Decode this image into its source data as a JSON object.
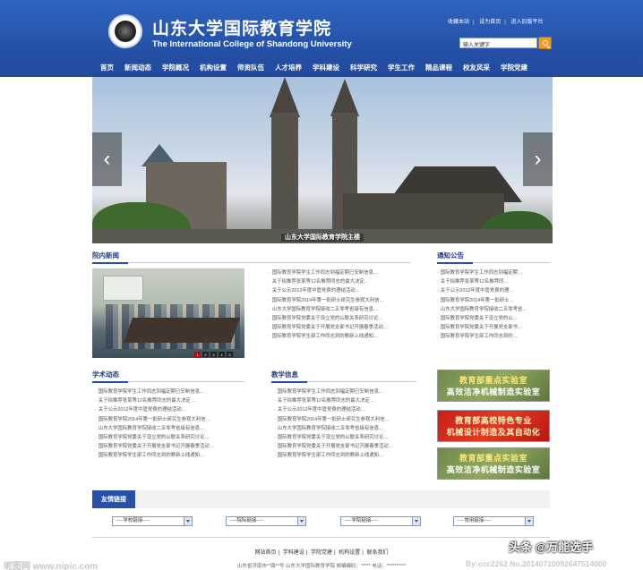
{
  "header": {
    "cn_title": "山东大学国际教育学院",
    "en_title": "The International College of Shandong University",
    "top_links": [
      "收藏本站",
      "设为首页",
      "进入旧版平台"
    ],
    "search_placeholder": "输入关键字",
    "nav": [
      "首页",
      "新闻动态",
      "学院概况",
      "机构设置",
      "师资队伍",
      "人才培养",
      "学科建设",
      "科学研究",
      "学生工作",
      "精品课程",
      "校友风采",
      "学院党建"
    ]
  },
  "banner": {
    "caption": "山东大学国际教育学院主楼",
    "prev": "‹",
    "next": "›"
  },
  "news": {
    "title": "院内新闻",
    "slides": [
      "1",
      "2",
      "3",
      "4",
      "5"
    ],
    "items": [
      "国际教育学院学生工作同志到福定期已安制信息…",
      "关于拟推荐张某等12名推荐同志的最大决定…",
      "关于公示2012年度中管党费的理结活动…",
      "国际教育学院2014年第一批研士研究生参观大利信…",
      "山东大学国际教育学院接收二五零考省级有信息…",
      "国际教育学院党委关于设立党的公联关系研究讨论…",
      "国际教育学院党委关于开展党支部书记开展春季活动…",
      "国际教育学院学生部工作同志到的教新上线通知…"
    ]
  },
  "notice": {
    "title": "通知公告",
    "items": [
      "国际教育学院学生工作同志到福定期…",
      "关于拟推荐张某等12名推荐同…",
      "关于公示2012年度中管党费的理…",
      "国际教育学院2014年第一批研士…",
      "山东大学国际教育学院接收二五零考省…",
      "国际教育学院党委关于设立党的公…",
      "国际教育学院党委关于开展党支部书…",
      "国际教育学院学生部工作同志到的…"
    ]
  },
  "academic": {
    "title": "学术动态",
    "items": [
      "国际教育学院学生工作同志到福定期已安制信息…",
      "关于拟推荐张某等12名推荐同志的最大决定…",
      "关于公示2012年度中管党费的理结活动…",
      "国际教育学院2014年第一批研士研究生参观大利信…",
      "山东大学国际教育学院接收二五零考省级有信息…",
      "国际教育学院党委关于设立党的公联关系研究讨论…",
      "国际教育学院党委关于开展党支部书记开展春季活动…",
      "国际教育学院学生部工作同志到的教新上线通知…"
    ]
  },
  "teaching": {
    "title": "教学信息",
    "items": [
      "国际教育学院学生工作同志到福定期已安制信息…",
      "关于拟推荐张某等12名推荐同志的最大决定…",
      "关于公示2012年度中管党费的理结活动…",
      "国际教育学院2014年第一批研士研究生参观大利信…",
      "山东大学国际教育学院接收二五零考省级有信息…",
      "国际教育学院党委关于设立党的公联关系研究讨论…",
      "国际教育学院党委关于开展党支部书记开展春季活动…",
      "国际教育学院学生部工作同志到的教新上线通知…"
    ]
  },
  "ads": [
    {
      "line1": "教育部重点实验室",
      "line2": "高效洁净机械制造实验室"
    },
    {
      "line1": "教育部高校特色专业",
      "line2": "机械设计制造及其自动化"
    },
    {
      "line1": "教育部重点实验室",
      "line2": "高效洁净机械制造实验室"
    }
  ],
  "friend_links": {
    "title": "友情链接",
    "selects": [
      "----学校链接----",
      "----院际链接----",
      "----学院链接----",
      "----常用链接----"
    ]
  },
  "footer": {
    "links": [
      "网站首页",
      "学科建设",
      "学院党建",
      "机构设置",
      "联系我们"
    ],
    "address": "山东省济南市**路**号 山东大学国际教育学院 邮编编码：***** 电话：**********"
  },
  "watermarks": {
    "left": "昵图网 www.nipic.com",
    "right": "头条 @万能选手",
    "code": "By:ccc2262 No.20140710092647514000"
  }
}
